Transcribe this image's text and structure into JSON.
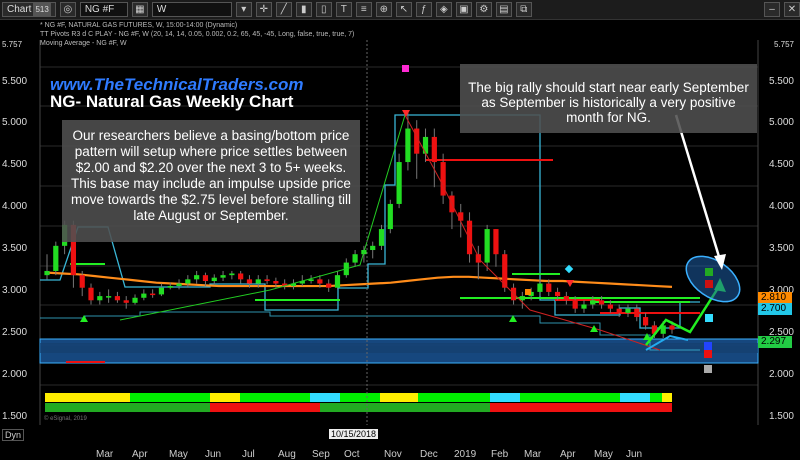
{
  "toolbar": {
    "chart_label": "Chart",
    "chart_badge": "513",
    "symbol": "NG #F",
    "interval": "W"
  },
  "header": {
    "line1": "* NG #F, NATURAL GAS FUTURES, W, 15:00-14:00 (Dynamic)",
    "line2": "TT Pivots R3 d C PLAY - NG #F, W (20, 14, 14, 0.05, 0.002, 0.2, 65, 45, -45, Long, false, true, true, 7)",
    "line3": "Moving Average - NG #F, W",
    "top_left_price": "5.757",
    "top_right_price": "5.757"
  },
  "site_url": "www.TheTechnicalTraders.com",
  "chart_title": "NG- Natural Gas Weekly Chart",
  "note_left": "Our researchers believe a basing/bottom price pattern will setup where price settles between $2.00 and $2.20 over the next 3 to 5+ weeks.  This base may include an impulse upside price move towards the $2.75 level before stalling till late August or September.",
  "note_right": "The big rally should start near early September as September is historically a very positive month for NG.",
  "y_axis_labels": [
    "5.500",
    "5.000",
    "4.500",
    "4.000",
    "3.500",
    "3.000",
    "2.500",
    "2.000",
    "1.500"
  ],
  "y_axis_left_labels": [
    "5.500",
    "5.000",
    "4.500",
    "4.000",
    "3.500",
    "3.000",
    "2.500",
    "2.000",
    "1.500"
  ],
  "x_axis_labels": [
    "Mar",
    "Apr",
    "May",
    "Jun",
    "Jul",
    "Aug",
    "Sep",
    "Oct",
    "Nov",
    "Dec",
    "2019",
    "Feb",
    "Mar",
    "Apr",
    "May",
    "Jun"
  ],
  "x_cursor_label": "10/15/2018",
  "price_tags": [
    {
      "text": "2.810",
      "bg": "#ff8a00",
      "color": "#000"
    },
    {
      "text": "2.700",
      "bg": "#22c7e8",
      "color": "#000"
    },
    {
      "text": "2.297",
      "bg": "#22cc44",
      "color": "#000"
    }
  ],
  "footer_left": "Dyn",
  "footer_copyright": "© eSignal, 2019",
  "colors": {
    "background": "#000000",
    "up_candle": "#22dd22",
    "down_candle": "#ee1111",
    "ma_line": "#ff8c1a",
    "pivot_line": "#39b6d6",
    "target_zone": "#1e5fa8"
  },
  "chart_data": {
    "type": "candlestick",
    "title": "NG- Natural Gas Weekly Chart",
    "ylim": [
      1.4,
      5.757
    ],
    "x": [
      "Mar",
      "Apr",
      "May",
      "Jun",
      "Jul",
      "Aug",
      "Sep",
      "Oct",
      "Nov",
      "Dec",
      "2019",
      "Feb",
      "Mar",
      "Apr",
      "May",
      "Jun"
    ],
    "candles": [
      [
        2.95,
        3.0,
        2.9,
        3.2
      ],
      [
        3.0,
        3.3,
        2.95,
        3.35
      ],
      [
        3.3,
        3.55,
        3.2,
        3.6
      ],
      [
        3.55,
        2.95,
        2.8,
        3.6
      ],
      [
        2.95,
        2.8,
        2.7,
        3.0
      ],
      [
        2.8,
        2.65,
        2.6,
        2.85
      ],
      [
        2.65,
        2.7,
        2.6,
        2.75
      ],
      [
        2.7,
        2.7,
        2.62,
        2.78
      ],
      [
        2.7,
        2.65,
        2.62,
        2.75
      ],
      [
        2.65,
        2.62,
        2.55,
        2.7
      ],
      [
        2.62,
        2.68,
        2.6,
        2.72
      ],
      [
        2.68,
        2.73,
        2.65,
        2.78
      ],
      [
        2.73,
        2.72,
        2.68,
        2.78
      ],
      [
        2.72,
        2.8,
        2.7,
        2.85
      ],
      [
        2.8,
        2.82,
        2.78,
        2.86
      ],
      [
        2.82,
        2.85,
        2.78,
        2.9
      ],
      [
        2.85,
        2.9,
        2.8,
        2.95
      ],
      [
        2.9,
        2.95,
        2.85,
        3.0
      ],
      [
        2.95,
        2.88,
        2.82,
        2.98
      ],
      [
        2.88,
        2.92,
        2.84,
        2.96
      ],
      [
        2.92,
        2.95,
        2.88,
        3.0
      ],
      [
        2.95,
        2.97,
        2.9,
        3.0
      ],
      [
        2.97,
        2.9,
        2.85,
        3.0
      ],
      [
        2.9,
        2.85,
        2.8,
        2.95
      ],
      [
        2.85,
        2.9,
        2.8,
        2.95
      ],
      [
        2.9,
        2.88,
        2.84,
        2.95
      ],
      [
        2.88,
        2.85,
        2.8,
        2.92
      ],
      [
        2.85,
        2.82,
        2.78,
        2.9
      ],
      [
        2.82,
        2.85,
        2.78,
        2.9
      ],
      [
        2.85,
        2.88,
        2.82,
        2.95
      ],
      [
        2.88,
        2.9,
        2.85,
        2.95
      ],
      [
        2.9,
        2.85,
        2.8,
        2.95
      ],
      [
        2.85,
        2.8,
        2.75,
        2.9
      ],
      [
        2.8,
        2.95,
        2.78,
        3.0
      ],
      [
        2.95,
        3.1,
        2.92,
        3.15
      ],
      [
        3.1,
        3.2,
        3.05,
        3.25
      ],
      [
        3.2,
        3.25,
        3.1,
        3.3
      ],
      [
        3.25,
        3.3,
        3.15,
        3.35
      ],
      [
        3.3,
        3.5,
        3.25,
        3.55
      ],
      [
        3.5,
        3.8,
        3.45,
        3.85
      ],
      [
        3.8,
        4.3,
        3.75,
        4.4
      ],
      [
        4.3,
        4.7,
        4.2,
        4.9
      ],
      [
        4.7,
        4.4,
        4.1,
        4.8
      ],
      [
        4.4,
        4.6,
        4.3,
        4.7
      ],
      [
        4.6,
        4.3,
        4.0,
        4.7
      ],
      [
        4.3,
        3.9,
        3.8,
        4.4
      ],
      [
        3.9,
        3.7,
        3.5,
        3.95
      ],
      [
        3.7,
        3.6,
        3.4,
        3.8
      ],
      [
        3.6,
        3.2,
        3.1,
        3.7
      ],
      [
        3.2,
        3.1,
        2.9,
        3.3
      ],
      [
        3.1,
        3.5,
        3.0,
        3.55
      ],
      [
        3.5,
        3.2,
        3.05,
        3.5
      ],
      [
        3.2,
        2.8,
        2.75,
        3.25
      ],
      [
        2.8,
        2.65,
        2.6,
        2.85
      ],
      [
        2.65,
        2.7,
        2.55,
        2.75
      ],
      [
        2.7,
        2.75,
        2.65,
        2.8
      ],
      [
        2.75,
        2.85,
        2.7,
        2.9
      ],
      [
        2.85,
        2.75,
        2.7,
        2.9
      ],
      [
        2.75,
        2.7,
        2.65,
        2.8
      ],
      [
        2.7,
        2.65,
        2.6,
        2.75
      ],
      [
        2.65,
        2.55,
        2.5,
        2.7
      ],
      [
        2.55,
        2.6,
        2.5,
        2.65
      ],
      [
        2.6,
        2.65,
        2.55,
        2.7
      ],
      [
        2.65,
        2.6,
        2.55,
        2.7
      ],
      [
        2.6,
        2.55,
        2.5,
        2.65
      ],
      [
        2.55,
        2.5,
        2.45,
        2.6
      ],
      [
        2.5,
        2.55,
        2.45,
        2.6
      ],
      [
        2.55,
        2.45,
        2.4,
        2.6
      ],
      [
        2.45,
        2.35,
        2.3,
        2.5
      ],
      [
        2.35,
        2.25,
        2.2,
        2.4
      ],
      [
        2.25,
        2.35,
        2.2,
        2.4
      ],
      [
        2.35,
        2.3,
        2.25,
        2.4
      ]
    ],
    "moving_average": [
      2.98,
      2.97,
      2.96,
      2.94,
      2.92,
      2.9,
      2.88,
      2.86,
      2.85,
      2.84,
      2.83,
      2.82,
      2.82,
      2.82,
      2.82,
      2.82,
      2.82,
      2.82,
      2.82,
      2.83,
      2.84,
      2.85,
      2.86,
      2.88,
      2.9,
      2.92,
      2.93,
      2.93,
      2.92,
      2.91,
      2.9,
      2.89,
      2.88,
      2.88,
      2.87,
      2.86,
      2.85,
      2.84,
      2.83,
      2.82,
      2.81
    ]
  }
}
